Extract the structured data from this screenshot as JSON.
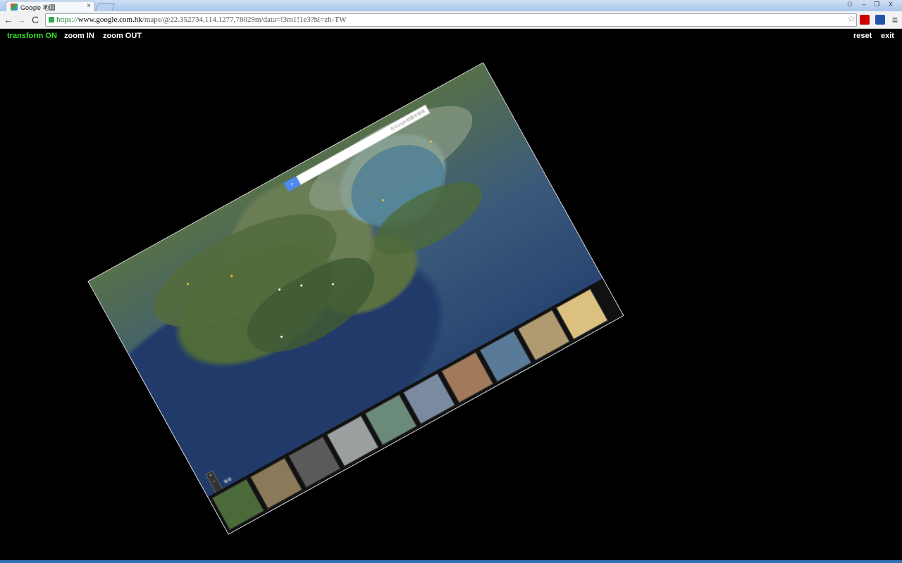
{
  "browser": {
    "tab_title": "Google 地圖",
    "tab_close": "×",
    "omnibox": {
      "scheme": "https://",
      "host": "www.google.com.hk",
      "path": "/maps/@22.352734,114.1277,78029m/data=!3m1!1e3?hl=zh-TW"
    },
    "back": "←",
    "forward": "→",
    "reload": "C",
    "star": "☆",
    "menu": "≡",
    "window_minimize": "–",
    "window_restore": "❐",
    "window_close": "X",
    "window_user": "⚇"
  },
  "overlay": {
    "transform": "transform ON",
    "zoom_in": "zoom IN",
    "zoom_out": "zoom OUT",
    "reset": "reset",
    "exit": "exit"
  },
  "map": {
    "search_placeholder": "在Google地圖中搜尋",
    "search_icon": "magnifier-icon",
    "zoom_plus": "+",
    "zoom_minus": "−",
    "mode": "衛星",
    "filmstrip": [
      {
        "label": "",
        "color": "#4a6a3a"
      },
      {
        "label": "",
        "color": "#8a7a5a"
      },
      {
        "label": "",
        "color": "#5a5a5a"
      },
      {
        "label": "",
        "color": "#9aa0a0"
      },
      {
        "label": "",
        "color": "#6a8a7a"
      },
      {
        "label": "",
        "color": "#7a8aa0"
      },
      {
        "label": "",
        "color": "#a07a5a"
      },
      {
        "label": "",
        "color": "#5a7a9a"
      },
      {
        "label": "",
        "color": "#b09a70"
      },
      {
        "label": "",
        "color": "#dcc080"
      }
    ]
  },
  "colors": {
    "accent_transform": "#36e02b",
    "page_background": "#000000",
    "bottom_bar": "#2f6fb5"
  }
}
